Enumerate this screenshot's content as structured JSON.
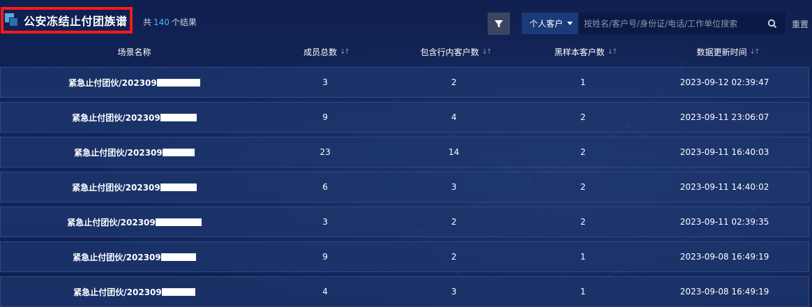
{
  "header": {
    "title": "公安冻结止付团族谱",
    "result_prefix": "共",
    "result_count": "140",
    "result_suffix": "个结果",
    "filter_icon": "filter-icon",
    "customer_type": "个人客户",
    "search_placeholder": "按姓名/客户号/身份证/电话/工作单位搜索",
    "search_icon": "search-icon",
    "reset_label": "重置"
  },
  "table": {
    "columns": [
      {
        "label": "场景名称",
        "sortable": false
      },
      {
        "label": "成员总数",
        "sortable": true
      },
      {
        "label": "包含行内客户数",
        "sortable": true
      },
      {
        "label": "黑样本客户数",
        "sortable": true
      },
      {
        "label": "数据更新时间",
        "sortable": true
      }
    ],
    "sort_glyph": "↓↑",
    "rows": [
      {
        "scene": "紧急止付团伙/202309",
        "members": "3",
        "in_bank": "2",
        "black": "1",
        "updated": "2023-09-12 02:39:47"
      },
      {
        "scene": "紧急止付团伙/202309",
        "members": "9",
        "in_bank": "4",
        "black": "2",
        "updated": "2023-09-11 23:06:07"
      },
      {
        "scene": "紧急止付团伙/202309",
        "members": "23",
        "in_bank": "14",
        "black": "2",
        "updated": "2023-09-11 16:40:03"
      },
      {
        "scene": "紧急止付团伙/202309",
        "members": "6",
        "in_bank": "3",
        "black": "2",
        "updated": "2023-09-11 14:40:02"
      },
      {
        "scene": "紧急止付团伙/202309",
        "members": "3",
        "in_bank": "2",
        "black": "2",
        "updated": "2023-09-11 02:39:35"
      },
      {
        "scene": "紧急止付团伙/202309",
        "members": "9",
        "in_bank": "2",
        "black": "1",
        "updated": "2023-09-08 16:49:19"
      },
      {
        "scene": "紧急止付团伙/202309",
        "members": "4",
        "in_bank": "3",
        "black": "1",
        "updated": "2023-09-08 16:49:19"
      }
    ]
  },
  "colors": {
    "background": "#0f2050",
    "highlight_border": "#ff1a1a",
    "count_accent": "#4fb0ff",
    "row_background": "#1e376e"
  }
}
